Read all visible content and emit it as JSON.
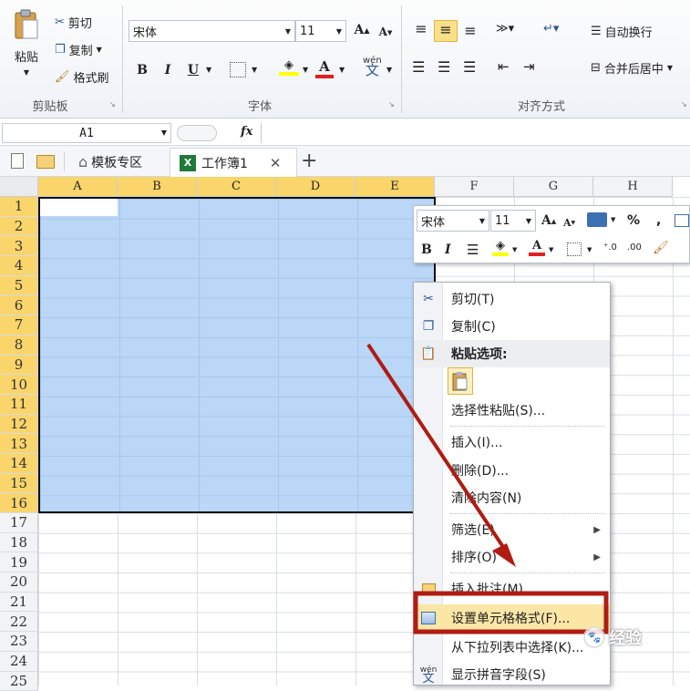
{
  "ribbon": {
    "clipboard": {
      "paste": "粘贴",
      "cut": "剪切",
      "copy": "复制",
      "format_painter": "格式刷",
      "group": "剪贴板"
    },
    "font": {
      "name": "宋体",
      "size": "11",
      "bold": "B",
      "italic": "I",
      "underline": "U",
      "group": "字体"
    },
    "align": {
      "wrap": "自动换行",
      "merge": "合并后居中",
      "group": "对齐方式"
    }
  },
  "formula": {
    "cell_ref": "A1",
    "fx": "fx",
    "value": ""
  },
  "tabs": {
    "template": "模板专区",
    "workbook": "工作簿1",
    "add": "+"
  },
  "columns": [
    "A",
    "B",
    "C",
    "D",
    "E",
    "F",
    "G",
    "H"
  ],
  "rows": [
    "1",
    "2",
    "3",
    "4",
    "5",
    "6",
    "7",
    "8",
    "9",
    "10",
    "11",
    "12",
    "13",
    "14",
    "15",
    "16",
    "17",
    "18",
    "19",
    "20",
    "21",
    "22",
    "23",
    "24",
    "25"
  ],
  "selection": {
    "cols": 5,
    "rows": 16
  },
  "mini_toolbar": {
    "font": "宋体",
    "size": "11",
    "bold": "B",
    "italic": "I",
    "percent": "%",
    "comma": ","
  },
  "context_menu": [
    {
      "label": "剪切(T)",
      "icon": "scissors-icon"
    },
    {
      "label": "复制(C)",
      "icon": "copy-icon"
    },
    {
      "label": "粘贴选项:",
      "icon": "paste-icon"
    },
    {
      "label": "选择性粘贴(S)...",
      "icon": ""
    },
    {
      "label": "插入(I)...",
      "icon": ""
    },
    {
      "label": "删除(D)...",
      "icon": ""
    },
    {
      "label": "清除内容(N)",
      "icon": ""
    },
    {
      "label": "筛选(E)",
      "icon": "",
      "submenu": true
    },
    {
      "label": "排序(O)",
      "icon": "",
      "submenu": true
    },
    {
      "label": "插入批注(M)",
      "icon": "comment-icon"
    },
    {
      "label": "设置单元格格式(F)...",
      "icon": "format-cells-icon",
      "highlighted": true
    },
    {
      "label": "从下拉列表中选择(K)...",
      "icon": ""
    },
    {
      "label": "显示拼音字段(S)",
      "icon": "phonetic-icon"
    }
  ],
  "watermark": "经验",
  "colors": {
    "selection": "#bad7f8",
    "header_selected": "#f9d56b",
    "annotation": "#b01c12"
  }
}
